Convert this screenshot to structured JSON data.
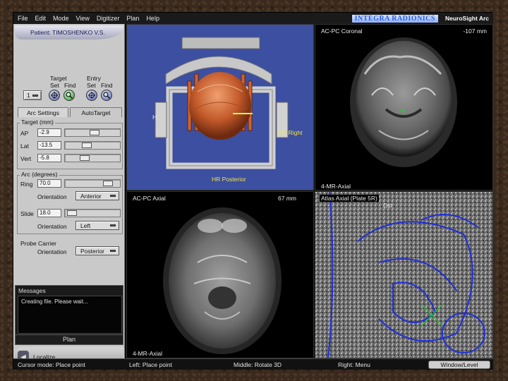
{
  "menu": [
    "File",
    "Edit",
    "Mode",
    "View",
    "Digitizer",
    "Plan",
    "Help"
  ],
  "brand": {
    "logo": "INTEGRA RADIONICS",
    "product": "NeuroSight Arc"
  },
  "patient": {
    "label": "Patient: TIMOSHENKO V.S."
  },
  "target_entry": {
    "target_label": "Target",
    "entry_label": "Entry",
    "set_label": "Set",
    "find_label": "Find",
    "selector_value": "1"
  },
  "tabs": [
    {
      "label": "Arc Settings",
      "active": true
    },
    {
      "label": "AutoTarget",
      "active": false
    }
  ],
  "target": {
    "title": "Target (mm)",
    "ap_label": "AP",
    "ap_value": "-2.9",
    "ap_fraction": 0.55,
    "lat_label": "Lat",
    "lat_value": "-13.5",
    "lat_fraction": 0.38,
    "vert_label": "Vert",
    "vert_value": "-5.8",
    "vert_fraction": 0.33
  },
  "arc": {
    "title": "Arc (degrees)",
    "ring_label": "Ring",
    "ring_value": "70.0",
    "ring_fraction": 0.85,
    "ring_orientation_label": "Orientation",
    "ring_orientation": "Anterior",
    "slide_label": "Slide",
    "slide_value": "18.0",
    "slide_fraction": 0.05,
    "slide_orientation_label": "Orientation",
    "slide_orientation": "Left"
  },
  "probe": {
    "title": "Probe Carrier",
    "orientation_label": "Orientation",
    "orientation": "Posterior"
  },
  "messages": {
    "title": "Messages",
    "text": "Creating file. Please wait..."
  },
  "plan_button": "Plan",
  "localize_label": "Localize",
  "viewports": {
    "three_d": {
      "label_left": "H",
      "label_right": "HR Right",
      "label_bottom": "HR Posterior"
    },
    "coronal": {
      "title": "AC-PC Coronal",
      "distance": "-107 mm",
      "footer": "4-MR-Axial"
    },
    "axial": {
      "title": "AC-PC Axial",
      "distance": "67 mm",
      "footer": "4-MR-Axial"
    },
    "atlas": {
      "title": "Atlas Axial (Plate 5R)",
      "suffix": "Dst"
    }
  },
  "status": {
    "cursor_mode": "Cursor mode: Place point",
    "left": "Left: Place point",
    "middle": "Middle: Rotate 3D",
    "right": "Right: Menu",
    "window_level": "Window/Level"
  },
  "colors": {
    "accent": "#3c4fa0",
    "atlas_outline": "#1f2fd8",
    "crosshair": "#1dd12a"
  }
}
